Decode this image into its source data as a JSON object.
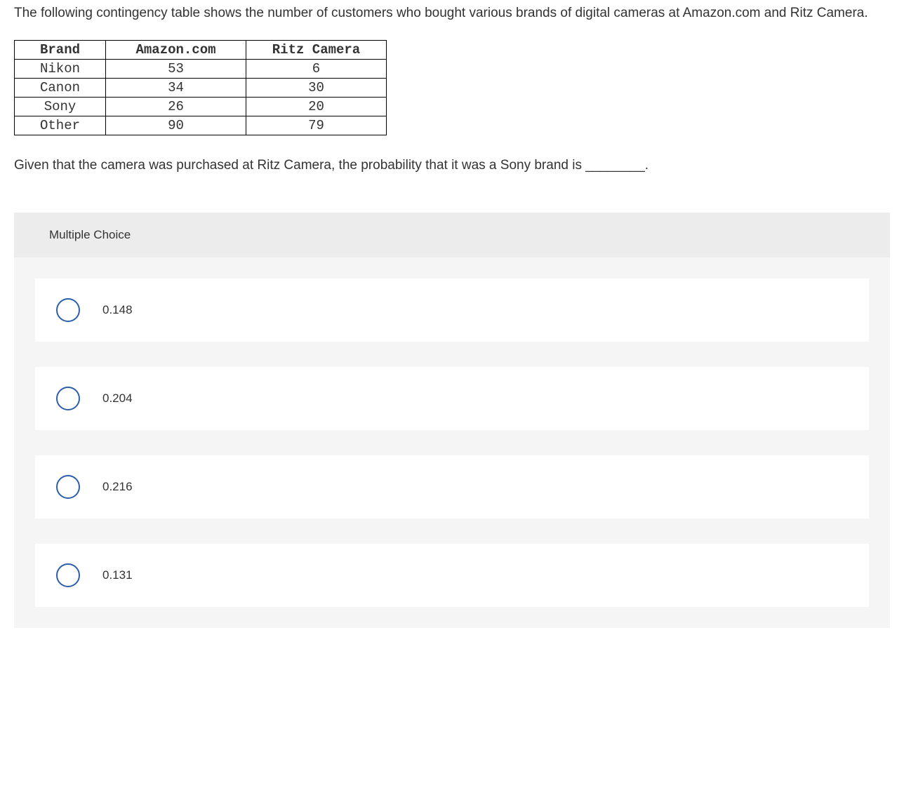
{
  "intro": "The following contingency table shows the number of customers who bought various brands of digital cameras at Amazon.com and Ritz Camera.",
  "table": {
    "headers": [
      "Brand",
      "Amazon.com",
      "Ritz Camera"
    ],
    "rows": [
      {
        "brand": "Nikon",
        "amazon": "53",
        "ritz": "6"
      },
      {
        "brand": "Canon",
        "amazon": "34",
        "ritz": "30"
      },
      {
        "brand": "Sony",
        "amazon": "26",
        "ritz": "20"
      },
      {
        "brand": "Other",
        "amazon": "90",
        "ritz": "79"
      }
    ]
  },
  "question": "Given that the camera was purchased at Ritz Camera, the probability that it was a Sony brand is ________.",
  "mc": {
    "title": "Multiple Choice",
    "options": [
      "0.148",
      "0.204",
      "0.216",
      "0.131"
    ]
  }
}
